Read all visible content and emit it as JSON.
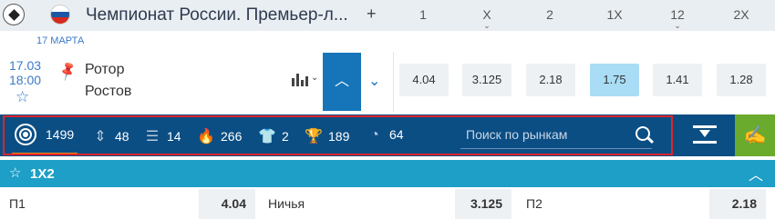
{
  "header": {
    "title": "Чемпионат России. Премьер-л...",
    "add_label": "+",
    "columns": [
      {
        "label": "1",
        "caret": ""
      },
      {
        "label": "X",
        "caret": "⌄"
      },
      {
        "label": "2",
        "caret": ""
      },
      {
        "label": "1X",
        "caret": ""
      },
      {
        "label": "12",
        "caret": "⌄"
      },
      {
        "label": "2X",
        "caret": ""
      }
    ]
  },
  "date_label": "17 МАРТА",
  "match": {
    "date": "17.03",
    "time": "18:00",
    "team_home": "Ротор",
    "team_away": "Ростов",
    "odds": [
      {
        "value": "4.04",
        "selected": false
      },
      {
        "value": "3.125",
        "selected": false
      },
      {
        "value": "2.18",
        "selected": false
      },
      {
        "value": "1.75",
        "selected": true
      },
      {
        "value": "1.41",
        "selected": false
      },
      {
        "value": "1.28",
        "selected": false
      }
    ]
  },
  "markets": {
    "items": [
      {
        "icon": "all-markets-icon",
        "count": "1499"
      },
      {
        "icon": "sort-updown-icon",
        "count": "48"
      },
      {
        "icon": "list-bars-icon",
        "count": "14"
      },
      {
        "icon": "fire-icon",
        "count": "266"
      },
      {
        "icon": "shirt-icon",
        "count": "2"
      },
      {
        "icon": "trophy-icon",
        "count": "189"
      },
      {
        "icon": "timer-icon",
        "count": "64"
      }
    ],
    "search_placeholder": "Поиск по рынкам"
  },
  "section": {
    "title": "1X2"
  },
  "outcomes": [
    {
      "name": "П1",
      "value": "4.04"
    },
    {
      "name": "Ничья",
      "value": "3.125"
    },
    {
      "name": "П2",
      "value": "2.18"
    }
  ],
  "colors": {
    "market_bar": "#0b4e84",
    "section_bar": "#1d9fc7",
    "selected_odd": "#a9ddf5",
    "live_button": "#6aaa2d",
    "highlight_outline": "#e0242a"
  }
}
